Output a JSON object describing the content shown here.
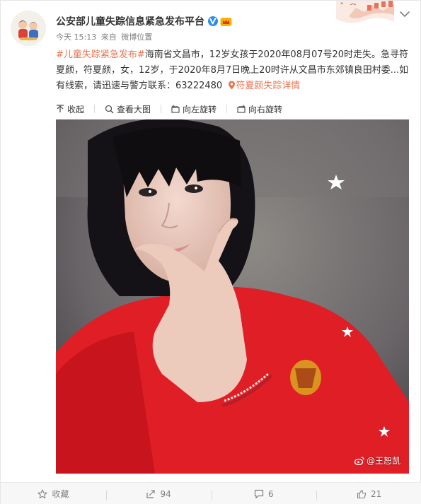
{
  "post": {
    "username": "公安部儿童失踪信息紧急发布平台",
    "time": "今天 15:13",
    "from_label": "来自",
    "source": "微博位置",
    "hashtag": "#儿童失踪紧急发布#",
    "text": "海南省文昌市，12岁女孩于2020年08月07号20时走失。急寻符夏颜，符夏颜，女，12岁，于2020年8月7日晚上20时许从文昌市东郊镇良田村委...如有线索，请迅速与警方联系：",
    "phone": "63222480",
    "detail_link": "符夏颜失踪详情"
  },
  "media_toolbar": {
    "collapse": "收起",
    "view_large": "查看大图",
    "rotate_left": "向左旋转",
    "rotate_right": "向右旋转"
  },
  "photo": {
    "watermark": "@王恕凯"
  },
  "actions": {
    "favorite": "收藏",
    "repost_count": "94",
    "comment_count": "6",
    "like_count": "21"
  },
  "icons": {
    "verified": "verified-badge-icon",
    "vip": "vip-crown-icon",
    "dropdown": "chevron-down-icon",
    "link": "location-pin-icon"
  },
  "colors": {
    "link": "#eb7350",
    "verified": "#2d8cf0",
    "vip": "#f7b500",
    "muted": "#808080"
  }
}
